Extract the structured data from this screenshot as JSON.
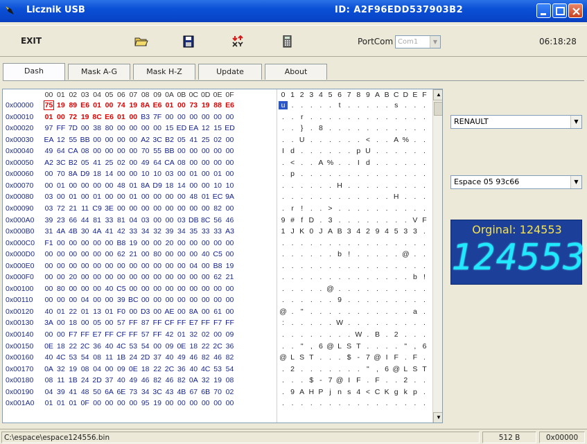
{
  "window": {
    "title": "Licznik USB",
    "device_id": "ID:  A2F96EDD537903B2"
  },
  "toolbar": {
    "exit_label": "EXIT",
    "icons": [
      "open-folder-icon",
      "save-disk-icon",
      "swap-arrows-icon",
      "calculator-icon"
    ],
    "portcom_label": "PortCom",
    "portcom_value": "Com1",
    "clock": "06:18:28"
  },
  "tabs": [
    "Dash",
    "Mask A-G",
    "Mask H-Z",
    "Update",
    "About"
  ],
  "hex": {
    "header": [
      "00",
      "01",
      "02",
      "03",
      "04",
      "05",
      "06",
      "07",
      "08",
      "09",
      "0A",
      "0B",
      "0C",
      "0D",
      "0E",
      "0F"
    ],
    "ascii_header": [
      "0",
      "1",
      "2",
      "3",
      "4",
      "5",
      "6",
      "7",
      "8",
      "9",
      "A",
      "B",
      "C",
      "D",
      "E",
      "F"
    ],
    "rows": [
      {
        "addr": "0x00000",
        "bytes": "75 19 89 E6 01 00 74 19 8A E6 01 00 73 19 88 E6",
        "ascii": "u . . . . . t . . . . . s . . ."
      },
      {
        "addr": "0x00010",
        "bytes": "01 00 72 19 8C E6 01 00 B3 7F 00 00 00 00 00 00",
        "ascii": ". . r . . . . . . . . . . . . ."
      },
      {
        "addr": "0x00020",
        "bytes": "97 FF 7D 00 38 80 00 00 00 00 15 ED EA 12 15 ED",
        "ascii": ". . } . 8 . . . . . . . . . . ."
      },
      {
        "addr": "0x00030",
        "bytes": "EA 12 55 BB 00 00 00 00 A2 3C B2 05 41 25 02 00",
        "ascii": ". . U . . . . . . < . . A % . ."
      },
      {
        "addr": "0x00040",
        "bytes": "49 64 CA 08 00 00 00 00 70 55 BB 00 00 00 00 00",
        "ascii": "I d . . . . . . p U . . . . . ."
      },
      {
        "addr": "0x00050",
        "bytes": "A2 3C B2 05 41 25 02 00 49 64 CA 08 00 00 00 00",
        "ascii": ". < . . A % . . I d . . . . . ."
      },
      {
        "addr": "0x00060",
        "bytes": "00 70 8A D9 18 14 00 00 10 10 03 00 01 00 01 00",
        "ascii": ". p . . . . . . . . . . . . . ."
      },
      {
        "addr": "0x00070",
        "bytes": "00 01 00 00 00 00 48 01 8A D9 18 14 00 00 10 10",
        "ascii": ". . . . . . H . . . . . . . . ."
      },
      {
        "addr": "0x00080",
        "bytes": "03 00 01 00 01 00 00 01 00 00 00 00 48 01 EC 9A",
        "ascii": ". . . . . . . . . . . . H . . ."
      },
      {
        "addr": "0x00090",
        "bytes": "03 72 21 11 C9 3E 00 00 00 00 00 00 00 00 82 00",
        "ascii": ". r ! . . > . . . . . . . . . ."
      },
      {
        "addr": "0x000A0",
        "bytes": "39 23 66 44 81 33 81 04 03 00 00 03 DB 8C 56 46",
        "ascii": "9 # f D . 3 . . . . . . . . V F"
      },
      {
        "addr": "0x000B0",
        "bytes": "31 4A 4B 30 4A 41 42 33 34 32 39 34 35 33 33 A3",
        "ascii": "1 J K 0 J A B 3 4 2 9 4 5 3 3 ."
      },
      {
        "addr": "0x000C0",
        "bytes": "F1 00 00 00 00 00 B8 19 00 00 20 00 00 00 00 00",
        "ascii": ". . . . . . . . . . . . . . . ."
      },
      {
        "addr": "0x000D0",
        "bytes": "00 00 00 00 00 00 62 21 00 80 00 00 00 40 C5 00",
        "ascii": ". . . . . . b ! . . . . . @ . ."
      },
      {
        "addr": "0x000E0",
        "bytes": "00 00 00 00 00 00 00 00 00 00 00 00 04 00 B8 19",
        "ascii": ". . . . . . . . . . . . . . . ."
      },
      {
        "addr": "0x000F0",
        "bytes": "00 00 20 00 00 00 00 00 00 00 00 00 00 00 62 21",
        "ascii": ". . . . . . . . . . . . . . b !"
      },
      {
        "addr": "0x00100",
        "bytes": "00 80 00 00 00 40 C5 00 00 00 00 00 00 00 00 00",
        "ascii": ". . . . . @ . . . . . . . . . ."
      },
      {
        "addr": "0x00110",
        "bytes": "00 00 00 04 00 00 39 BC 00 00 00 00 00 00 00 00",
        "ascii": ". . . . . . 9 . . . . . . . . ."
      },
      {
        "addr": "0x00120",
        "bytes": "40 01 22 01 13 01 F0 00 D3 00 AE 00 8A 00 61 00",
        "ascii": "@ . \" . . . . . . . . . . . a ."
      },
      {
        "addr": "0x00130",
        "bytes": "3A 00 18 00 05 00 57 FF 87 FF CF FF E7 FF F7 FF",
        "ascii": ": . . . . . W . . . . . . . . ."
      },
      {
        "addr": "0x00140",
        "bytes": "00 00 F7 FF E7 FF CF FF 57 FF 42 01 32 02 00 09",
        "ascii": ". . . . . . . . W . B . 2 . . ."
      },
      {
        "addr": "0x00150",
        "bytes": "0E 18 22 2C 36 40 4C 53 54 00 09 0E 18 22 2C 36",
        "ascii": ". . \" , 6 @ L S T . . . . \" , 6"
      },
      {
        "addr": "0x00160",
        "bytes": "40 4C 53 54 08 11 1B 24 2D 37 40 49 46 82 46 82",
        "ascii": "@ L S T . . . $ - 7 @ I F . F ."
      },
      {
        "addr": "0x00170",
        "bytes": "0A 32 19 08 04 00 09 0E 18 22 2C 36 40 4C 53 54",
        "ascii": ". 2 . . . . . . . \" , 6 @ L S T"
      },
      {
        "addr": "0x00180",
        "bytes": "08 11 1B 24 2D 37 40 49 46 82 46 82 0A 32 19 08",
        "ascii": ". . . $ - 7 @ I F . F . . 2 . ."
      },
      {
        "addr": "0x00190",
        "bytes": "04 39 41 48 50 6A 6E 73 34 3C 43 4B 67 6B 70 02",
        "ascii": ". 9 A H P j n s 4 < C K g k p ."
      },
      {
        "addr": "0x001A0",
        "bytes": "01 01 01 0F 00 00 00 00 95 19 00 00 00 00 00 00",
        "ascii": ". . . . . . . . . . . . . . . ."
      }
    ]
  },
  "side": {
    "make_value": "RENAULT",
    "model_value": "Espace 05 93c66",
    "odometer_caption": "Orginal: 124553",
    "odometer_value": "124553"
  },
  "status": {
    "file_path": "C:\\espace\\espace124556.bin",
    "size": "512 B",
    "offset": "0x00000"
  },
  "colors": {
    "titlebar": "#0a50d6",
    "highlight_bytes": "#e00000",
    "odometer_bg": "#1c3f9a",
    "odometer_caption": "#f7e34c",
    "odometer_digits": "#1fe8ff"
  }
}
